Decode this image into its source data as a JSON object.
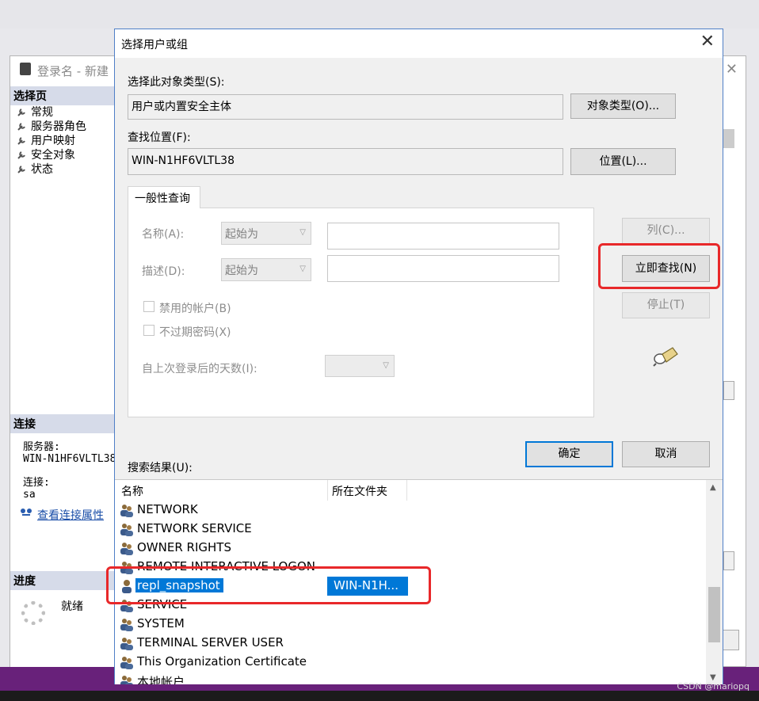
{
  "background_window": {
    "title": "登录名 - 新建",
    "pages_header": "选择页",
    "pages": [
      "常规",
      "服务器角色",
      "用户映射",
      "安全对象",
      "状态"
    ],
    "connection_header": "连接",
    "server_label": "服务器:",
    "server_value": "WIN-N1HF6VLTL38",
    "conn_label": "连接:",
    "conn_value": "sa",
    "view_conn_props": "查看连接属性",
    "progress_header": "进度",
    "status": "就绪"
  },
  "dialog": {
    "title": "选择用户或组",
    "object_type_label": "选择此对象类型(S):",
    "object_type_value": "用户或内置安全主体",
    "object_types_button": "对象类型(O)...",
    "location_label": "查找位置(F):",
    "location_value": "WIN-N1HF6VLTL38",
    "location_button": "位置(L)...",
    "query_tab": "一般性查询",
    "name_label": "名称(A):",
    "name_mode": "起始为",
    "desc_label": "描述(D):",
    "desc_mode": "起始为",
    "disabled_accounts": "禁用的帐户(B)",
    "non_expiring_pw": "不过期密码(X)",
    "days_since_logon": "自上次登录后的天数(I):",
    "columns_button": "列(C)...",
    "find_now_button": "立即查找(N)",
    "stop_button": "停止(T)",
    "ok_button": "确定",
    "cancel_button": "取消",
    "results_label": "搜索结果(U):",
    "col_name": "名称",
    "col_folder": "所在文件夹",
    "results": [
      {
        "name": "NETWORK",
        "folder": "",
        "icon": "group-icon"
      },
      {
        "name": "NETWORK SERVICE",
        "folder": "",
        "icon": "group-icon"
      },
      {
        "name": "OWNER RIGHTS",
        "folder": "",
        "icon": "group-icon"
      },
      {
        "name": "REMOTE INTERACTIVE LOGON",
        "folder": "",
        "icon": "group-icon"
      },
      {
        "name": "repl_snapshot",
        "folder": "WIN-N1H...",
        "icon": "user-icon",
        "selected": true
      },
      {
        "name": "SERVICE",
        "folder": "",
        "icon": "group-icon"
      },
      {
        "name": "SYSTEM",
        "folder": "",
        "icon": "group-icon"
      },
      {
        "name": "TERMINAL SERVER USER",
        "folder": "",
        "icon": "group-icon"
      },
      {
        "name": "This Organization Certificate",
        "folder": "",
        "icon": "group-icon"
      },
      {
        "name": "本地帐户",
        "folder": "",
        "icon": "group-icon"
      }
    ]
  },
  "watermark": "CSDN @mariopq",
  "colors": {
    "accent": "#0078d7",
    "highlight": "#e8282a",
    "vs_purple": "#68217a"
  }
}
